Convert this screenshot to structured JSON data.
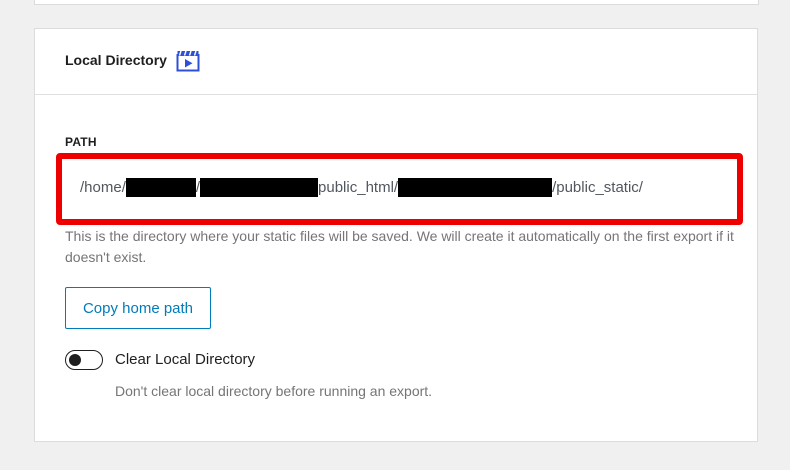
{
  "section": {
    "title": "Local Directory",
    "title_icon": "video-icon"
  },
  "path_field": {
    "label": "PATH",
    "value_parts": [
      "/home/",
      "/",
      "public_html/",
      "/public_static/"
    ],
    "redacted_segments": 3,
    "highlight_color": "#ee0000"
  },
  "help_text": "This is the directory where your static files will be saved. We will create it automatically on the first export if it doesn't exist.",
  "copy_button": {
    "label": "Copy home path"
  },
  "clear_toggle": {
    "label": "Clear Local Directory",
    "help": "Don't clear local directory before running an export.",
    "enabled": false
  },
  "colors": {
    "accent": "#007cba",
    "icon_blue": "#2f4fd8",
    "muted_text": "#757575"
  }
}
